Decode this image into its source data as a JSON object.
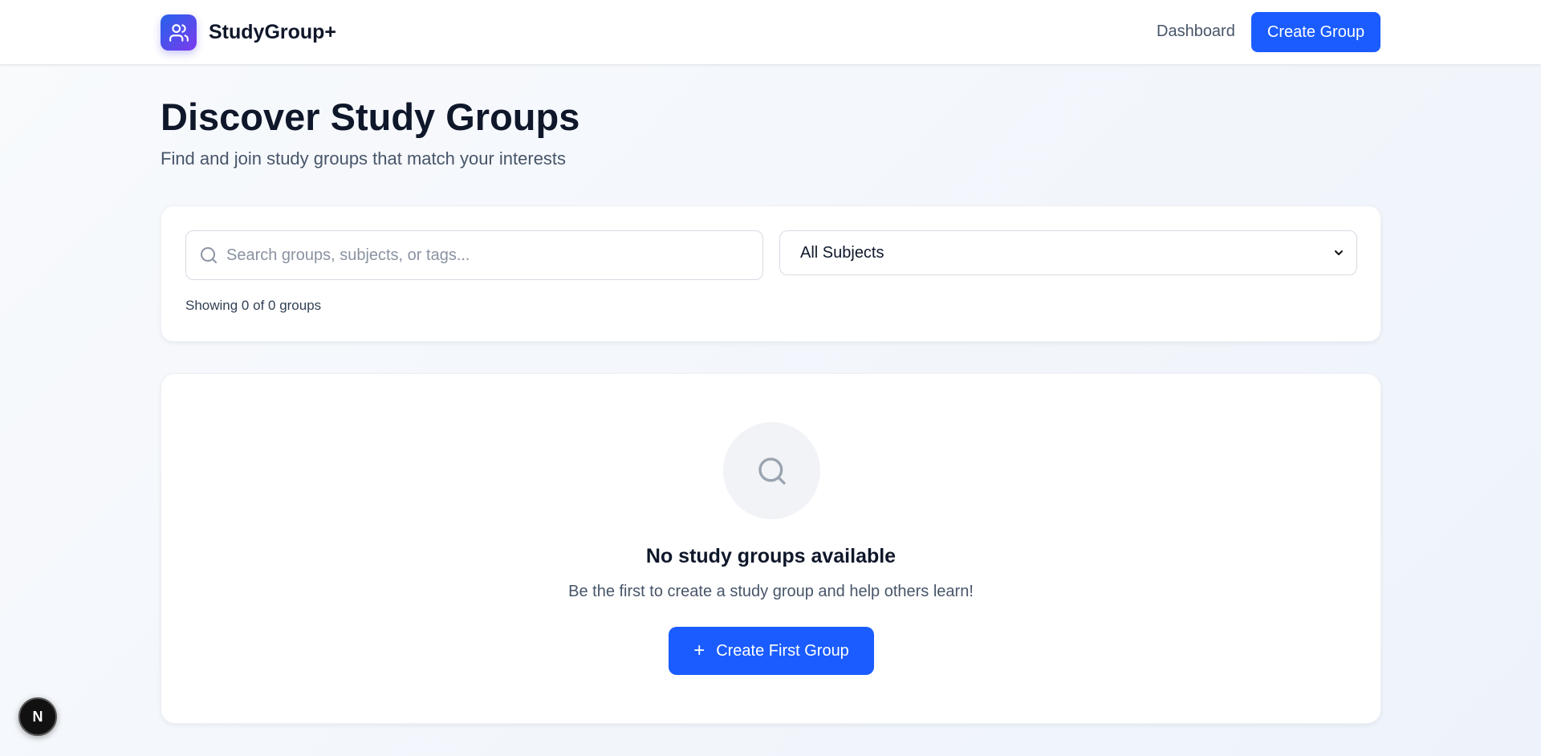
{
  "header": {
    "brand_name": "StudyGroup+",
    "brand_icon": "users-icon",
    "nav_dashboard": "Dashboard",
    "create_button": "Create Group"
  },
  "main": {
    "title": "Discover Study Groups",
    "subtitle": "Find and join study groups that match your interests"
  },
  "filters": {
    "search_placeholder": "Search groups, subjects, or tags...",
    "search_value": "",
    "subject_selected": "All Subjects",
    "result_count": "Showing 0 of 0 groups"
  },
  "empty_state": {
    "icon": "search-icon",
    "title": "No study groups available",
    "description": "Be the first to create a study group and help others learn!",
    "button_label": "Create First Group",
    "button_icon": "plus-icon"
  },
  "dev_badge": {
    "letter": "N"
  },
  "colors": {
    "accent": "#1a5cff",
    "logo_gradient_start": "#2563eb",
    "logo_gradient_end": "#7c3aed"
  }
}
